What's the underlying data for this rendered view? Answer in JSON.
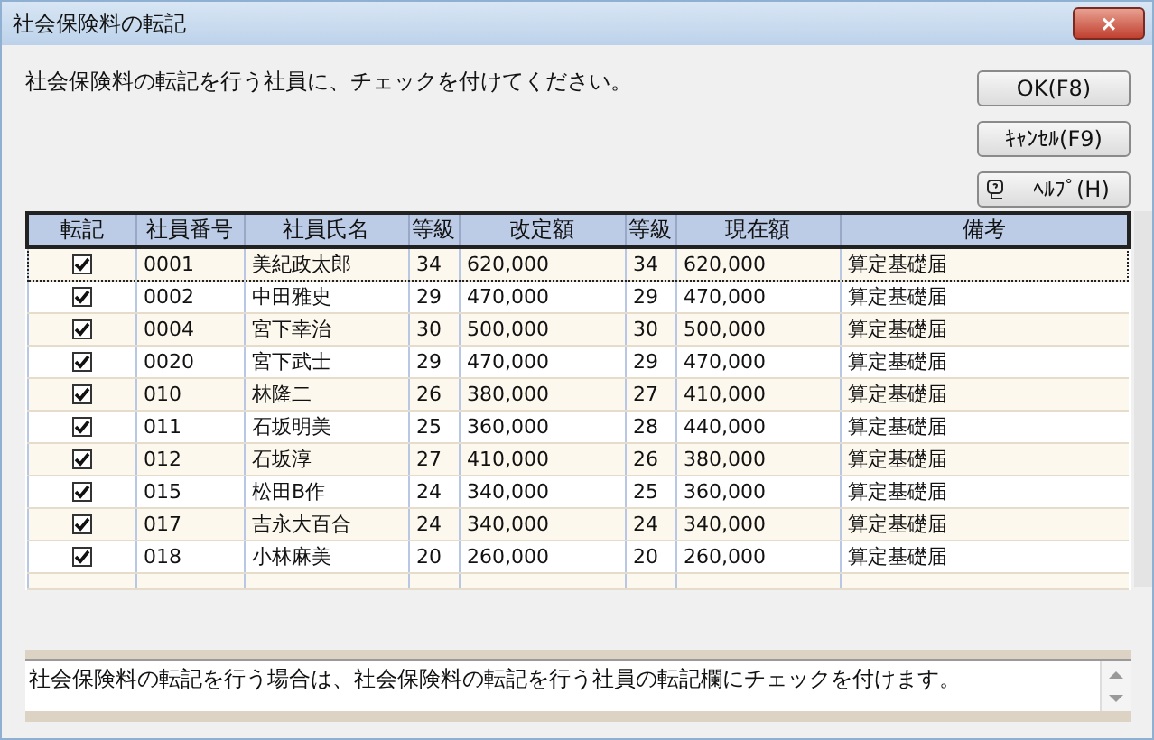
{
  "window": {
    "title": "社会保険料の転記",
    "close": "×"
  },
  "instruction": "社会保険料の転記を行う社員に、チェックを付けてください。",
  "buttons": [
    {
      "kind": "ok",
      "label": "OK(F8)"
    },
    {
      "kind": "cancel",
      "label": "ｷｬﾝｾﾙ(F9)"
    },
    {
      "kind": "help",
      "label": "ﾍﾙﾌﾟ(H)"
    }
  ],
  "table": {
    "columns": [
      "転記",
      "社員番号",
      "社員氏名",
      "等級",
      "改定額",
      "等級",
      "現在額",
      "備考"
    ],
    "rows": [
      {
        "checked": true,
        "focused": true,
        "cells": [
          "",
          "0001",
          "美紀政太郎",
          "34",
          "620,000",
          "34",
          "620,000",
          "算定基礎届"
        ]
      },
      {
        "checked": true,
        "focused": false,
        "cells": [
          "",
          "0002",
          "中田雅史",
          "29",
          "470,000",
          "29",
          "470,000",
          "算定基礎届"
        ]
      },
      {
        "checked": true,
        "focused": false,
        "cells": [
          "",
          "0004",
          "宮下幸治",
          "30",
          "500,000",
          "30",
          "500,000",
          "算定基礎届"
        ]
      },
      {
        "checked": true,
        "focused": false,
        "cells": [
          "",
          "0020",
          "宮下武士",
          "29",
          "470,000",
          "29",
          "470,000",
          "算定基礎届"
        ]
      },
      {
        "checked": true,
        "focused": false,
        "cells": [
          "",
          "010",
          "林隆二",
          "26",
          "380,000",
          "27",
          "410,000",
          "算定基礎届"
        ]
      },
      {
        "checked": true,
        "focused": false,
        "cells": [
          "",
          "011",
          "石坂明美",
          "25",
          "360,000",
          "28",
          "440,000",
          "算定基礎届"
        ]
      },
      {
        "checked": true,
        "focused": false,
        "cells": [
          "",
          "012",
          "石坂淳",
          "27",
          "410,000",
          "26",
          "380,000",
          "算定基礎届"
        ]
      },
      {
        "checked": true,
        "focused": false,
        "cells": [
          "",
          "015",
          "松田B作",
          "24",
          "340,000",
          "25",
          "360,000",
          "算定基礎届"
        ]
      },
      {
        "checked": true,
        "focused": false,
        "cells": [
          "",
          "017",
          "吉永大百合",
          "24",
          "340,000",
          "24",
          "340,000",
          "算定基礎届"
        ]
      },
      {
        "checked": true,
        "focused": false,
        "cells": [
          "",
          "018",
          "小林麻美",
          "20",
          "260,000",
          "20",
          "260,000",
          "算定基礎届"
        ]
      }
    ]
  },
  "description": "社会保険料の転記を行う場合は、社会保険料の転記を行う社員の転記欄にチェックを付けます。"
}
